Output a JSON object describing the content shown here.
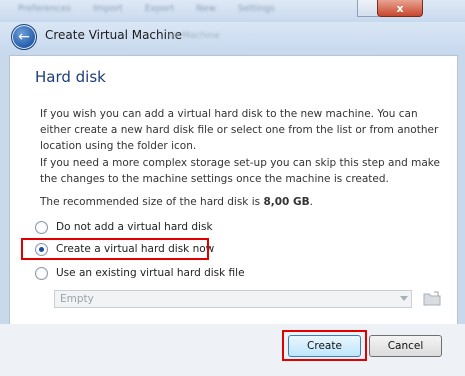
{
  "window": {
    "close_glyph": "x",
    "toolbar_blur": [
      "Preferences",
      "Import",
      "Export",
      "New",
      "Settings"
    ]
  },
  "header": {
    "title": "Create Virtual Machine",
    "blurred_text": "ne Machine"
  },
  "content": {
    "section_title": "Hard disk",
    "paragraph1": "If you wish you can add a virtual hard disk to the new machine. You can either create a new hard disk file or select one from the list or from another location using the folder icon.",
    "paragraph2": "If you need a more complex storage set-up you can skip this step and make the changes to the machine settings once the machine is created.",
    "size_prefix": "The recommended size of the hard disk is ",
    "size_value": "8,00 GB",
    "size_suffix": "."
  },
  "options": {
    "no_disk": "Do not add a virtual hard disk",
    "create_now": "Create a virtual hard disk now",
    "use_existing": "Use an existing virtual hard disk file",
    "selected": "create_now"
  },
  "existing_disk": {
    "value": "Empty"
  },
  "buttons": {
    "create": "Create",
    "cancel": "Cancel"
  },
  "colors": {
    "highlight": "#e00000",
    "section_title": "#1e3d7a"
  }
}
